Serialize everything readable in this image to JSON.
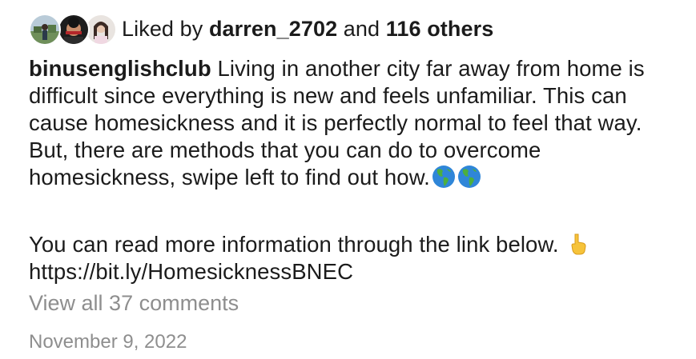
{
  "likes": {
    "prefix": "Liked by ",
    "user": "darren_2702",
    "middle": " and ",
    "others": "116 others"
  },
  "caption": {
    "username": "binusenglishclub",
    "text": " Living in another city far away from home is difficult since everything is new and feels unfamiliar. This can cause homesickness and it is perfectly normal to feel that way. But, there are methods that you can do to overcome homesickness, swipe left to find out how.",
    "emoji_1": "globe-americas-emoji",
    "emoji_2": "globe-americas-emoji",
    "more_info": "You can read more information through the link below.",
    "emoji_3": "pointing-down-hand-emoji",
    "link": "https://bit.ly/HomesicknessBNEC"
  },
  "comments": {
    "view_all": "View all 37 comments"
  },
  "date": "November 9, 2022",
  "colors": {
    "text": "#1b1b1b",
    "muted": "#8e8e8e"
  }
}
